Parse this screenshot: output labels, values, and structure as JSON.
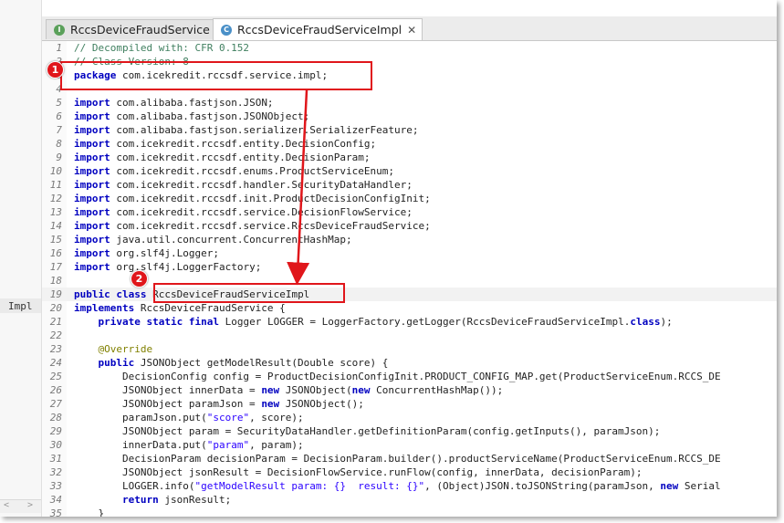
{
  "side_label": "Impl",
  "scroll_left": "<",
  "scroll_right": ">",
  "tabs": [
    {
      "icon_letter": "I",
      "icon_color": "#5aa05a",
      "label": "RccsDeviceFraudService",
      "close": "✕"
    },
    {
      "icon_letter": "C",
      "icon_color": "#4a90c8",
      "label": "RccsDeviceFraudServiceImpl",
      "close": "✕"
    }
  ],
  "badges": [
    "1",
    "2"
  ],
  "lines": [
    {
      "n": "1",
      "parts": [
        [
          "cm",
          "// Decompiled with: CFR 0.152"
        ]
      ]
    },
    {
      "n": "2",
      "parts": [
        [
          "cm",
          "// Class Version: 8"
        ]
      ]
    },
    {
      "n": "3",
      "parts": [
        [
          "kw",
          "package"
        ],
        [
          "",
          " com.icekredit.rccsdf.service.impl;"
        ]
      ]
    },
    {
      "n": "4",
      "parts": []
    },
    {
      "n": "5",
      "parts": [
        [
          "kw",
          "import"
        ],
        [
          "",
          " com.alibaba.fastjson.JSON;"
        ]
      ]
    },
    {
      "n": "6",
      "parts": [
        [
          "kw",
          "import"
        ],
        [
          "",
          " com.alibaba.fastjson.JSONObject;"
        ]
      ]
    },
    {
      "n": "7",
      "parts": [
        [
          "kw",
          "import"
        ],
        [
          "",
          " com.alibaba.fastjson.serializer.SerializerFeature;"
        ]
      ]
    },
    {
      "n": "8",
      "parts": [
        [
          "kw",
          "import"
        ],
        [
          "",
          " com.icekredit.rccsdf.entity.DecisionConfig;"
        ]
      ]
    },
    {
      "n": "9",
      "parts": [
        [
          "kw",
          "import"
        ],
        [
          "",
          " com.icekredit.rccsdf.entity.DecisionParam;"
        ]
      ]
    },
    {
      "n": "10",
      "parts": [
        [
          "kw",
          "import"
        ],
        [
          "",
          " com.icekredit.rccsdf.enums.ProductServiceEnum;"
        ]
      ]
    },
    {
      "n": "11",
      "parts": [
        [
          "kw",
          "import"
        ],
        [
          "",
          " com.icekredit.rccsdf.handler.SecurityDataHandler;"
        ]
      ]
    },
    {
      "n": "12",
      "parts": [
        [
          "kw",
          "import"
        ],
        [
          "",
          " com.icekredit.rccsdf.init.ProductDecisionConfigInit;"
        ]
      ]
    },
    {
      "n": "13",
      "parts": [
        [
          "kw",
          "import"
        ],
        [
          "",
          " com.icekredit.rccsdf.service.DecisionFlowService;"
        ]
      ]
    },
    {
      "n": "14",
      "parts": [
        [
          "kw",
          "import"
        ],
        [
          "",
          " com.icekredit.rccsdf.service.RccsDeviceFraudService;"
        ]
      ]
    },
    {
      "n": "15",
      "parts": [
        [
          "kw",
          "import"
        ],
        [
          "",
          " java.util.concurrent.ConcurrentHashMap;"
        ]
      ]
    },
    {
      "n": "16",
      "parts": [
        [
          "kw",
          "import"
        ],
        [
          "",
          " org.slf4j.Logger;"
        ]
      ]
    },
    {
      "n": "17",
      "parts": [
        [
          "kw",
          "import"
        ],
        [
          "",
          " org.slf4j.LoggerFactory;"
        ]
      ]
    },
    {
      "n": "18",
      "parts": []
    },
    {
      "n": "19",
      "parts": [
        [
          "kw",
          "public"
        ],
        [
          "",
          " "
        ],
        [
          "kw",
          "class"
        ],
        [
          "",
          " RccsDeviceFraudServiceImpl"
        ]
      ],
      "current": true
    },
    {
      "n": "20",
      "parts": [
        [
          "kw",
          "implements"
        ],
        [
          "",
          " RccsDeviceFraudService {"
        ]
      ]
    },
    {
      "n": "21",
      "parts": [
        [
          "",
          "    "
        ],
        [
          "kw",
          "private"
        ],
        [
          "",
          " "
        ],
        [
          "kw",
          "static"
        ],
        [
          "",
          " "
        ],
        [
          "kw",
          "final"
        ],
        [
          "",
          " Logger LOGGER = LoggerFactory.getLogger(RccsDeviceFraudServiceImpl."
        ],
        [
          "kw",
          "class"
        ],
        [
          "",
          ");"
        ]
      ]
    },
    {
      "n": "22",
      "parts": []
    },
    {
      "n": "23",
      "parts": [
        [
          "",
          "    "
        ],
        [
          "an",
          "@Override"
        ]
      ]
    },
    {
      "n": "24",
      "parts": [
        [
          "",
          "    "
        ],
        [
          "kw",
          "public"
        ],
        [
          "",
          " JSONObject getModelResult(Double score) {"
        ]
      ]
    },
    {
      "n": "25",
      "parts": [
        [
          "",
          "        DecisionConfig config = ProductDecisionConfigInit.PRODUCT_CONFIG_MAP.get(ProductServiceEnum.RCCS_DE"
        ]
      ]
    },
    {
      "n": "26",
      "parts": [
        [
          "",
          "        JSONObject innerData = "
        ],
        [
          "kw",
          "new"
        ],
        [
          "",
          " JSONObject("
        ],
        [
          "kw",
          "new"
        ],
        [
          "",
          " ConcurrentHashMap());"
        ]
      ]
    },
    {
      "n": "27",
      "parts": [
        [
          "",
          "        JSONObject paramJson = "
        ],
        [
          "kw",
          "new"
        ],
        [
          "",
          " JSONObject();"
        ]
      ]
    },
    {
      "n": "28",
      "parts": [
        [
          "",
          "        paramJson.put("
        ],
        [
          "st",
          "\"score\""
        ],
        [
          "",
          ", score);"
        ]
      ]
    },
    {
      "n": "29",
      "parts": [
        [
          "",
          "        JSONObject param = SecurityDataHandler.getDefinitionParam(config.getInputs(), paramJson);"
        ]
      ]
    },
    {
      "n": "30",
      "parts": [
        [
          "",
          "        innerData.put("
        ],
        [
          "st",
          "\"param\""
        ],
        [
          "",
          ", param);"
        ]
      ]
    },
    {
      "n": "31",
      "parts": [
        [
          "",
          "        DecisionParam decisionParam = DecisionParam.builder().productServiceName(ProductServiceEnum.RCCS_DE"
        ]
      ]
    },
    {
      "n": "32",
      "parts": [
        [
          "",
          "        JSONObject jsonResult = DecisionFlowService.runFlow(config, innerData, decisionParam);"
        ]
      ]
    },
    {
      "n": "33",
      "parts": [
        [
          "",
          "        LOGGER.info("
        ],
        [
          "st",
          "\"getModelResult param: {}  result: {}\""
        ],
        [
          "",
          ", (Object)JSON.toJSONString(paramJson, "
        ],
        [
          "kw",
          "new"
        ],
        [
          "",
          " Serial"
        ]
      ]
    },
    {
      "n": "34",
      "parts": [
        [
          "",
          "        "
        ],
        [
          "kw",
          "return"
        ],
        [
          "",
          " jsonResult;"
        ]
      ]
    },
    {
      "n": "35",
      "parts": [
        [
          "",
          "    }"
        ]
      ]
    }
  ]
}
